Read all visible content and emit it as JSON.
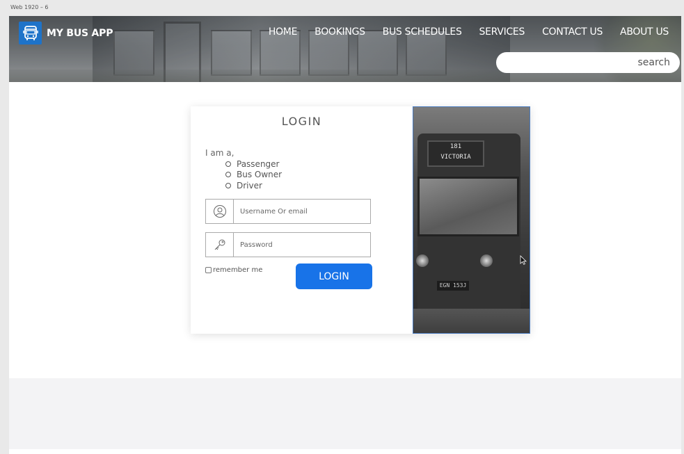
{
  "artboard": {
    "label": "Web 1920 – 6"
  },
  "header": {
    "app_name": "MY BUS APP",
    "nav": [
      "HOME",
      "BOOKINGS",
      "BUS SCHEDULES",
      "SERVICES",
      "CONTACT US",
      "ABOUT US"
    ],
    "search_placeholder": "search"
  },
  "login": {
    "title": "LOGIN",
    "role_intro": "I am a,",
    "roles": [
      "Passenger",
      "Bus Owner",
      "Driver"
    ],
    "username_placeholder": "Username Or email",
    "password_placeholder": "Password",
    "remember_label": "remember me",
    "button_label": "LOGIN"
  },
  "photo": {
    "destination_number": "181",
    "destination_name": "VICTORIA",
    "plate": "EGN 153J"
  },
  "colors": {
    "accent": "#1873e8",
    "logo_bg": "#1e73c9",
    "footer_band": "#f3f3f5"
  }
}
